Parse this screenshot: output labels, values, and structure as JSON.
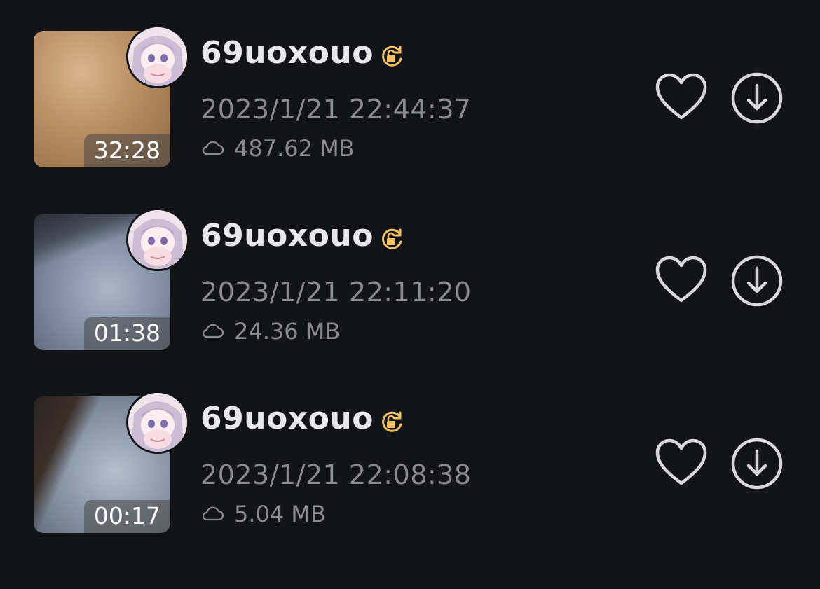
{
  "items": [
    {
      "author": "69uoxouo",
      "datetime": "2023/1/21 22:44:37",
      "size": "487.62 MB",
      "duration": "32:28"
    },
    {
      "author": "69uoxouo",
      "datetime": "2023/1/21 22:11:20",
      "size": "24.36 MB",
      "duration": "01:38"
    },
    {
      "author": "69uoxouo",
      "datetime": "2023/1/21 22:08:38",
      "size": "5.04 MB",
      "duration": "00:17"
    }
  ],
  "icons": {
    "badge": "lock-rotate-icon",
    "size": "cloud-icon",
    "favorite": "heart-icon",
    "download": "download-icon"
  },
  "colors": {
    "background": "#131418",
    "accent": "#f2c063",
    "muted_text": "#8a8b8f",
    "primary_text": "#e8e8ea",
    "icon_stroke": "#d8d8da"
  }
}
